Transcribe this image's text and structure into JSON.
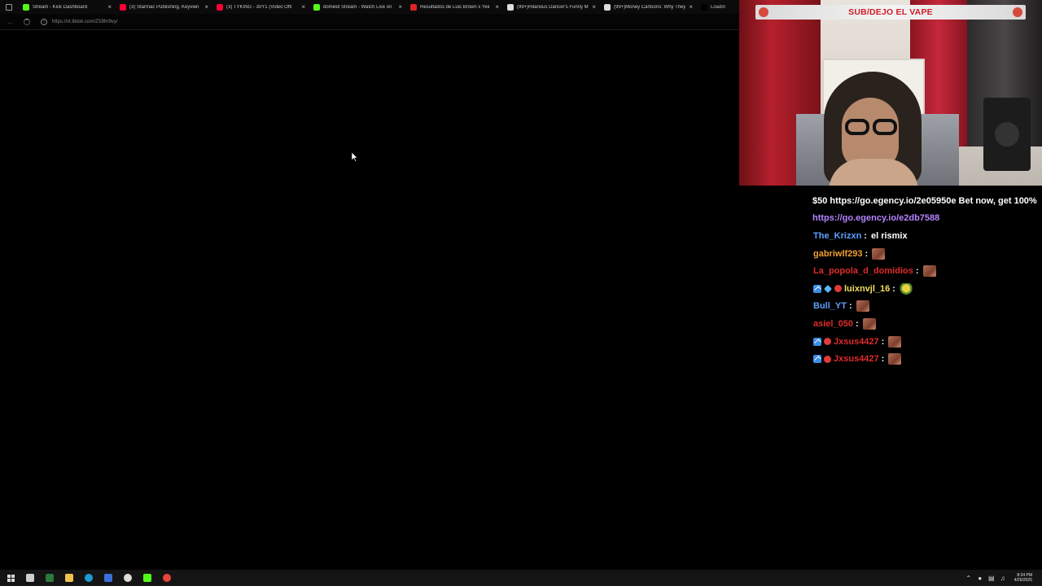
{
  "browser": {
    "tabs": [
      {
        "title": "Stream - Kick Dashboard",
        "favicon_color": "#53fc18"
      },
      {
        "title": "(3) Starmac Publishing, Keyvien",
        "favicon_color": "#ff0033"
      },
      {
        "title": "(3) TYKING - 30Y1 (Video Offi",
        "favicon_color": "#ff0033"
      },
      {
        "title": "domiilol Stream - Watch Live on",
        "favicon_color": "#53fc18"
      },
      {
        "title": "Resultados de Luis Brown x Yeii",
        "favicon_color": "#e02424"
      },
      {
        "title": "(99+)Hilarious Dancer's Funny M",
        "favicon_color": "#dddddd"
      },
      {
        "title": "(99+)Money Cartoons: Why They",
        "favicon_color": "#dddddd"
      },
      {
        "title": "Loading...",
        "favicon_color": "#000000"
      }
    ],
    "url": "https://vt.tiktok.com/ZS9hr9vy/"
  },
  "stream_overlay": {
    "banner_text": "SUB/DEJO EL VAPE"
  },
  "chat": {
    "messages": [
      {
        "type": "system",
        "text": "$50 https://go.egency.io/2e05950e Bet now, get 100%"
      },
      {
        "type": "link",
        "text": "https://go.egency.io/e2db7588"
      },
      {
        "type": "user",
        "user": "The_Krizxn",
        "user_color": "#5aa0ff",
        "message": "el rismix",
        "badges": []
      },
      {
        "type": "user",
        "user": "gabriwlf293",
        "user_color": "#f0a030",
        "message": "",
        "emote": "emote",
        "badges": []
      },
      {
        "type": "user",
        "user": "La_popola_d_domidios",
        "user_color": "#e02b2b",
        "message": "",
        "emote": "emote",
        "badges": []
      },
      {
        "type": "user",
        "user": "luixnvjl_16",
        "user_color": "#f0e060",
        "message": "",
        "emote": "turtle",
        "badges": [
          "pin",
          "gem",
          "rec"
        ]
      },
      {
        "type": "user",
        "user": "Bull_YT",
        "user_color": "#5aa0ff",
        "message": "",
        "emote": "emote",
        "badges": []
      },
      {
        "type": "user",
        "user": "asiel_050",
        "user_color": "#e02b2b",
        "message": "",
        "emote": "emote",
        "badges": []
      },
      {
        "type": "user",
        "user": "Jxsus4427",
        "user_color": "#e02b2b",
        "message": "",
        "emote": "emote",
        "badges": [
          "pin",
          "rec"
        ]
      },
      {
        "type": "user",
        "user": "Jxsus4427",
        "user_color": "#e02b2b",
        "message": "",
        "emote": "emote",
        "badges": [
          "pin",
          "rec"
        ]
      }
    ],
    "separator": ":"
  },
  "taskbar": {
    "apps": [
      {
        "name": "task-view",
        "color": "#cfcfcf"
      },
      {
        "name": "terminal",
        "color": "#2b7a3a"
      },
      {
        "name": "file-explorer",
        "color": "#f2c14e"
      },
      {
        "name": "edge",
        "color": "#1e9bd7"
      },
      {
        "name": "snipping-tool",
        "color": "#3b6fd8"
      },
      {
        "name": "obs",
        "color": "#dcdcdc"
      },
      {
        "name": "kick",
        "color": "#53fc18"
      },
      {
        "name": "chrome",
        "color": "#e8453c"
      }
    ],
    "time": "8:34 PM",
    "date": "4/26/2025"
  }
}
